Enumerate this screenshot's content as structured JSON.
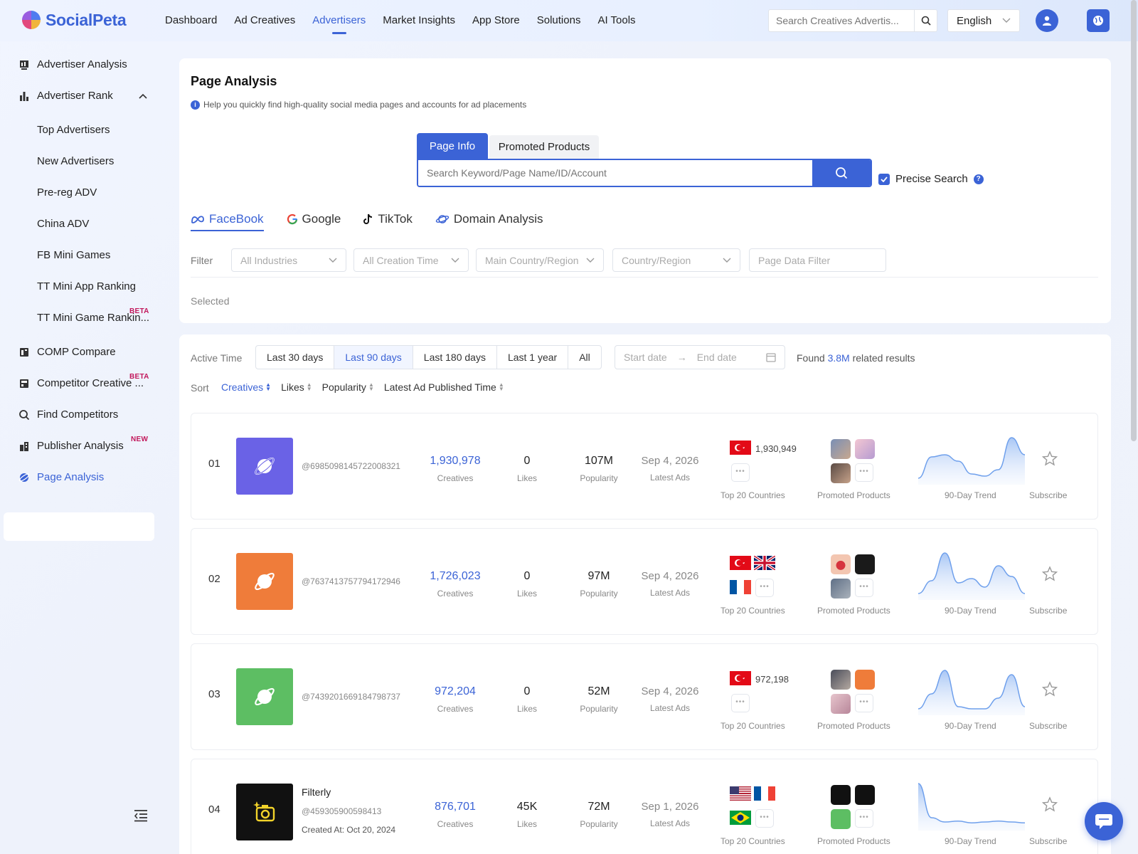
{
  "header": {
    "logo": "SocialPeta",
    "nav": [
      "Dashboard",
      "Ad Creatives",
      "Advertisers",
      "Market Insights",
      "App Store",
      "Solutions",
      "AI Tools"
    ],
    "active_nav": "Advertisers",
    "search_placeholder": "Search Creatives Advertis...",
    "language": "English"
  },
  "sidebar": {
    "advertiser_analysis": "Advertiser Analysis",
    "advertiser_rank": "Advertiser Rank",
    "rank_sub": [
      "Top Advertisers",
      "New Advertisers",
      "Pre-reg ADV",
      "China ADV",
      "FB Mini Games",
      "TT Mini App Ranking",
      "TT Mini Game Rankin..."
    ],
    "tt_mini_game_badge": "BETA",
    "comp_compare": "COMP Compare",
    "competitor_creative": "Competitor Creative ...",
    "competitor_creative_badge": "BETA",
    "find_competitors": "Find Competitors",
    "publisher_analysis": "Publisher Analysis",
    "publisher_badge": "NEW",
    "page_analysis": "Page Analysis"
  },
  "main": {
    "title": "Page Analysis",
    "help": "Help you quickly find high-quality social media pages and accounts for ad placements",
    "search_tabs": [
      "Page Info",
      "Promoted Products"
    ],
    "search_placeholder": "Search Keyword/Page Name/ID/Account",
    "precise_search": "Precise Search",
    "platform_tabs": [
      "FaceBook",
      "Google",
      "TikTok",
      "Domain Analysis"
    ],
    "filter_label": "Filter",
    "filters": [
      "All Industries",
      "All Creation Time",
      "Main Country/Region",
      "Country/Region",
      "Page Data Filter"
    ],
    "selected_label": "Selected",
    "active_time_label": "Active Time",
    "time_options": [
      "Last 30 days",
      "Last 90 days",
      "Last 180 days",
      "Last 1 year",
      "All"
    ],
    "active_time": "Last 90 days",
    "start_date": "Start date",
    "end_date": "End date",
    "found_prefix": "Found",
    "found_count": "3.8M",
    "found_suffix": "related results",
    "sort_label": "Sort",
    "sorts": [
      "Creatives",
      "Likes",
      "Popularity",
      "Latest Ad Published Time"
    ],
    "active_sort": "Creatives"
  },
  "row_labels": {
    "creatives": "Creatives",
    "likes": "Likes",
    "popularity": "Popularity",
    "latest_ads": "Latest Ads",
    "countries": "Top 20 Countries",
    "products": "Promoted Products",
    "trend": "90-Day Trend",
    "subscribe": "Subscribe",
    "more": "•••"
  },
  "rows": [
    {
      "rank": "01",
      "name": "",
      "id": "@6985098145722008321",
      "created": "",
      "creatives": "1,930,978",
      "likes": "0",
      "popularity": "107M",
      "latest": "Sep 4, 2026",
      "country_count": "1,930,949",
      "color": "#6a62e6",
      "trend": [
        0.05,
        0.55,
        0.6,
        0.45,
        0.15,
        0.1,
        0.25,
        1.0,
        0.6
      ]
    },
    {
      "rank": "02",
      "name": "",
      "id": "@7637413757794172946",
      "created": "",
      "creatives": "1,726,023",
      "likes": "0",
      "popularity": "97M",
      "latest": "Sep 4, 2026",
      "country_count": "",
      "color": "#ef7c3a",
      "trend": [
        0.05,
        0.35,
        1.0,
        0.3,
        0.4,
        0.2,
        0.7,
        0.45,
        0.05
      ]
    },
    {
      "rank": "03",
      "name": "",
      "id": "@7439201669184798737",
      "created": "",
      "creatives": "972,204",
      "likes": "0",
      "popularity": "52M",
      "latest": "Sep 4, 2026",
      "country_count": "972,198",
      "color": "#5dbe63",
      "trend": [
        0.05,
        0.4,
        0.95,
        0.1,
        0.05,
        0.05,
        0.3,
        0.85,
        0.1
      ]
    },
    {
      "rank": "04",
      "name": "Filterly",
      "id": "@459305900598413",
      "created": "Created At:  Oct 20, 2024",
      "creatives": "876,701",
      "likes": "45K",
      "popularity": "72M",
      "latest": "Sep 1, 2026",
      "country_count": "",
      "color": "#111111",
      "trend": [
        1.0,
        0.2,
        0.1,
        0.12,
        0.08,
        0.1,
        0.12,
        0.1,
        0.08
      ]
    }
  ],
  "colors": {
    "accent": "#3b63d6",
    "badge": "#c2185b"
  }
}
